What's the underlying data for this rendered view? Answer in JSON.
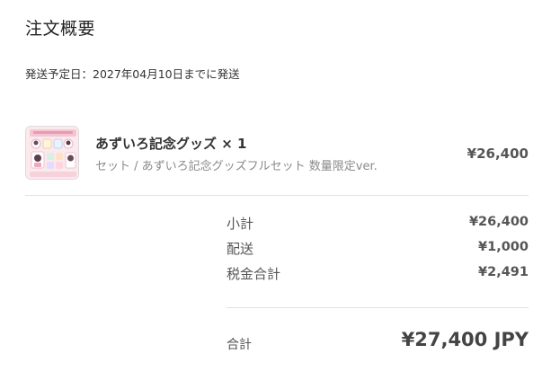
{
  "summary_title": "注文概要",
  "shipping_note": "発送予定日：2027年04月10日までに発送",
  "product": {
    "name": "あずいろ記念グッズ × 1",
    "variant": "セット / あずいろ記念グッズフルセット 数量限定ver.",
    "price": "¥26,400"
  },
  "totals": {
    "subtotal_label": "小計",
    "subtotal_value": "¥26,400",
    "shipping_label": "配送",
    "shipping_value": "¥1,000",
    "tax_label": "税金合計",
    "tax_value": "¥2,491",
    "total_label": "合計",
    "total_value": "¥27,400 JPY"
  }
}
